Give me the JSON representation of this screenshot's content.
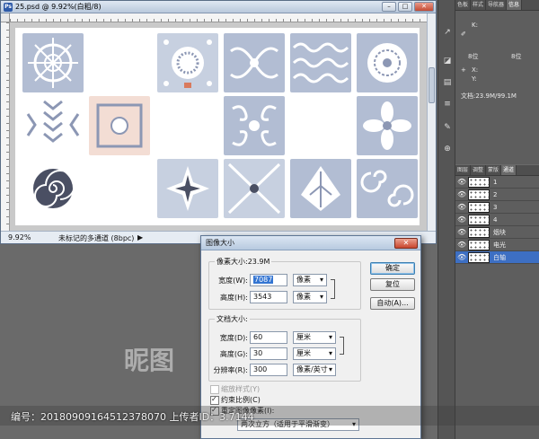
{
  "document": {
    "title": "25.psd @ 9.92%(白粗/8)",
    "zoom": "9.92%",
    "status_info": "未标记的多通道 (8bpc)",
    "status_arrow": "▶",
    "ps_icon": "Ps"
  },
  "window_buttons": {
    "minimize": "–",
    "restore": "□",
    "close": "✕"
  },
  "info_panel": {
    "tabs": [
      "色板",
      "样式",
      "导航器",
      "信息"
    ],
    "k_label": "K:",
    "k_cursor": "8位",
    "k_cursor2": "8位",
    "xy_x": "X:",
    "xy_y": "Y:",
    "doc_size": "文档:23.9M/99.1M"
  },
  "channels_panel": {
    "tabs": [
      "图层",
      "调整",
      "蒙版",
      "通道"
    ],
    "channels": [
      {
        "label": "1"
      },
      {
        "label": "2"
      },
      {
        "label": "3"
      },
      {
        "label": "4"
      },
      {
        "label": "烟块"
      },
      {
        "label": "电光"
      },
      {
        "label": "白轴"
      }
    ],
    "eye": "👁"
  },
  "dialog": {
    "title": "图像大小",
    "close": "✕",
    "pixel_dims": {
      "legend": "像素大小:23.9M",
      "width_label": "宽度(W):",
      "width_value": "7087",
      "width_unit": "像素",
      "height_label": "高度(H):",
      "height_value": "3543",
      "height_unit": "像素"
    },
    "doc_size": {
      "legend": "文档大小:",
      "width_label": "宽度(D):",
      "width_value": "60",
      "width_unit": "厘米",
      "height_label": "高度(G):",
      "height_value": "30",
      "height_unit": "厘米",
      "res_label": "分辨率(R):",
      "res_value": "300",
      "res_unit": "像素/英寸"
    },
    "buttons": {
      "ok": "确定",
      "reset": "复位",
      "auto": "自动(A)..."
    },
    "checkboxes": {
      "scale_styles": "缩放样式(Y)",
      "constrain": "约束比例(C)",
      "resample": "重定图像像素(I):"
    },
    "resample_method": "两次立方（适用于平滑渐变）"
  },
  "watermark": {
    "text": "编号：20180909164512378070 上传者ID：3.7144",
    "logo": "昵图"
  }
}
